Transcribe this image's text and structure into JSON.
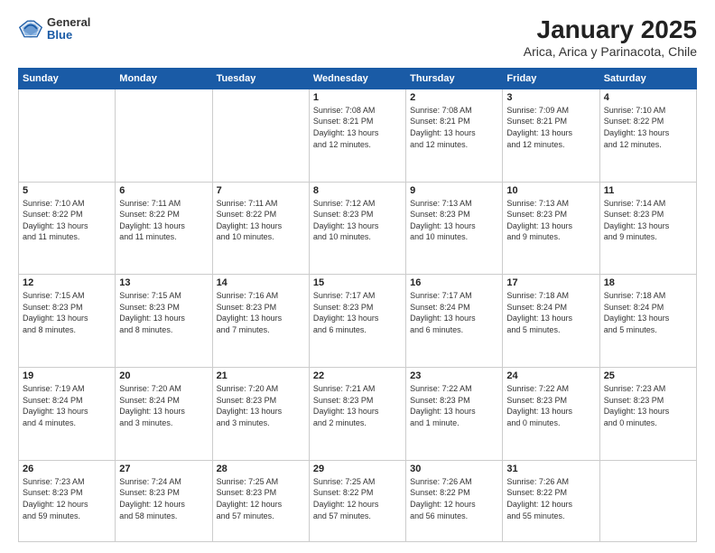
{
  "header": {
    "logo_general": "General",
    "logo_blue": "Blue",
    "title": "January 2025",
    "subtitle": "Arica, Arica y Parinacota, Chile"
  },
  "columns": [
    "Sunday",
    "Monday",
    "Tuesday",
    "Wednesday",
    "Thursday",
    "Friday",
    "Saturday"
  ],
  "weeks": [
    [
      {
        "day": "",
        "info": ""
      },
      {
        "day": "",
        "info": ""
      },
      {
        "day": "",
        "info": ""
      },
      {
        "day": "1",
        "info": "Sunrise: 7:08 AM\nSunset: 8:21 PM\nDaylight: 13 hours\nand 12 minutes."
      },
      {
        "day": "2",
        "info": "Sunrise: 7:08 AM\nSunset: 8:21 PM\nDaylight: 13 hours\nand 12 minutes."
      },
      {
        "day": "3",
        "info": "Sunrise: 7:09 AM\nSunset: 8:21 PM\nDaylight: 13 hours\nand 12 minutes."
      },
      {
        "day": "4",
        "info": "Sunrise: 7:10 AM\nSunset: 8:22 PM\nDaylight: 13 hours\nand 12 minutes."
      }
    ],
    [
      {
        "day": "5",
        "info": "Sunrise: 7:10 AM\nSunset: 8:22 PM\nDaylight: 13 hours\nand 11 minutes."
      },
      {
        "day": "6",
        "info": "Sunrise: 7:11 AM\nSunset: 8:22 PM\nDaylight: 13 hours\nand 11 minutes."
      },
      {
        "day": "7",
        "info": "Sunrise: 7:11 AM\nSunset: 8:22 PM\nDaylight: 13 hours\nand 10 minutes."
      },
      {
        "day": "8",
        "info": "Sunrise: 7:12 AM\nSunset: 8:23 PM\nDaylight: 13 hours\nand 10 minutes."
      },
      {
        "day": "9",
        "info": "Sunrise: 7:13 AM\nSunset: 8:23 PM\nDaylight: 13 hours\nand 10 minutes."
      },
      {
        "day": "10",
        "info": "Sunrise: 7:13 AM\nSunset: 8:23 PM\nDaylight: 13 hours\nand 9 minutes."
      },
      {
        "day": "11",
        "info": "Sunrise: 7:14 AM\nSunset: 8:23 PM\nDaylight: 13 hours\nand 9 minutes."
      }
    ],
    [
      {
        "day": "12",
        "info": "Sunrise: 7:15 AM\nSunset: 8:23 PM\nDaylight: 13 hours\nand 8 minutes."
      },
      {
        "day": "13",
        "info": "Sunrise: 7:15 AM\nSunset: 8:23 PM\nDaylight: 13 hours\nand 8 minutes."
      },
      {
        "day": "14",
        "info": "Sunrise: 7:16 AM\nSunset: 8:23 PM\nDaylight: 13 hours\nand 7 minutes."
      },
      {
        "day": "15",
        "info": "Sunrise: 7:17 AM\nSunset: 8:23 PM\nDaylight: 13 hours\nand 6 minutes."
      },
      {
        "day": "16",
        "info": "Sunrise: 7:17 AM\nSunset: 8:24 PM\nDaylight: 13 hours\nand 6 minutes."
      },
      {
        "day": "17",
        "info": "Sunrise: 7:18 AM\nSunset: 8:24 PM\nDaylight: 13 hours\nand 5 minutes."
      },
      {
        "day": "18",
        "info": "Sunrise: 7:18 AM\nSunset: 8:24 PM\nDaylight: 13 hours\nand 5 minutes."
      }
    ],
    [
      {
        "day": "19",
        "info": "Sunrise: 7:19 AM\nSunset: 8:24 PM\nDaylight: 13 hours\nand 4 minutes."
      },
      {
        "day": "20",
        "info": "Sunrise: 7:20 AM\nSunset: 8:24 PM\nDaylight: 13 hours\nand 3 minutes."
      },
      {
        "day": "21",
        "info": "Sunrise: 7:20 AM\nSunset: 8:23 PM\nDaylight: 13 hours\nand 3 minutes."
      },
      {
        "day": "22",
        "info": "Sunrise: 7:21 AM\nSunset: 8:23 PM\nDaylight: 13 hours\nand 2 minutes."
      },
      {
        "day": "23",
        "info": "Sunrise: 7:22 AM\nSunset: 8:23 PM\nDaylight: 13 hours\nand 1 minute."
      },
      {
        "day": "24",
        "info": "Sunrise: 7:22 AM\nSunset: 8:23 PM\nDaylight: 13 hours\nand 0 minutes."
      },
      {
        "day": "25",
        "info": "Sunrise: 7:23 AM\nSunset: 8:23 PM\nDaylight: 13 hours\nand 0 minutes."
      }
    ],
    [
      {
        "day": "26",
        "info": "Sunrise: 7:23 AM\nSunset: 8:23 PM\nDaylight: 12 hours\nand 59 minutes."
      },
      {
        "day": "27",
        "info": "Sunrise: 7:24 AM\nSunset: 8:23 PM\nDaylight: 12 hours\nand 58 minutes."
      },
      {
        "day": "28",
        "info": "Sunrise: 7:25 AM\nSunset: 8:23 PM\nDaylight: 12 hours\nand 57 minutes."
      },
      {
        "day": "29",
        "info": "Sunrise: 7:25 AM\nSunset: 8:22 PM\nDaylight: 12 hours\nand 57 minutes."
      },
      {
        "day": "30",
        "info": "Sunrise: 7:26 AM\nSunset: 8:22 PM\nDaylight: 12 hours\nand 56 minutes."
      },
      {
        "day": "31",
        "info": "Sunrise: 7:26 AM\nSunset: 8:22 PM\nDaylight: 12 hours\nand 55 minutes."
      },
      {
        "day": "",
        "info": ""
      }
    ]
  ]
}
